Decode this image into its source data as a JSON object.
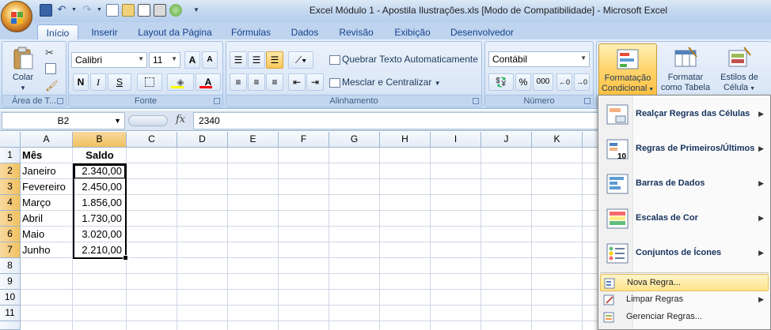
{
  "titlebar": {
    "title": "Excel Módulo 1 - Apostila Ilustrações.xls  [Modo de Compatibilidade] - Microsoft Excel"
  },
  "tabs": [
    {
      "label": "Início"
    },
    {
      "label": "Inserir"
    },
    {
      "label": "Layout da Página"
    },
    {
      "label": "Fórmulas"
    },
    {
      "label": "Dados"
    },
    {
      "label": "Revisão"
    },
    {
      "label": "Exibição"
    },
    {
      "label": "Desenvolvedor"
    }
  ],
  "ribbon": {
    "clipboard": {
      "paste_label": "Colar",
      "group_label": "Área de T..."
    },
    "font": {
      "name": "Calibri",
      "size": "11",
      "group_label": "Fonte",
      "bold": "N",
      "italic": "I",
      "underline": "S",
      "grow": "A",
      "shrink": "A",
      "color_letter": "A"
    },
    "alignment": {
      "wrap_label": "Quebrar Texto Automaticamente",
      "merge_label": "Mesclar e Centralizar",
      "group_label": "Alinhamento"
    },
    "number": {
      "format": "Contábil",
      "percent": "%",
      "thousands": "000",
      "group_label": "Número"
    },
    "styles": {
      "conditional_line1": "Formatação",
      "conditional_line2": "Condicional",
      "table_line1": "Formatar",
      "table_line2": "como Tabela",
      "cell_line1": "Estilos de",
      "cell_line2": "Célula"
    }
  },
  "formula_bar": {
    "name_box": "B2",
    "fx": "fx",
    "formula": "2340"
  },
  "grid": {
    "columns": [
      "A",
      "B",
      "C",
      "D",
      "E",
      "F",
      "G",
      "H",
      "I",
      "J",
      "K"
    ],
    "rows": [
      "1",
      "2",
      "3",
      "4",
      "5",
      "6",
      "7",
      "8",
      "9",
      "10",
      "11"
    ],
    "header": {
      "a": "Mês",
      "b": "Saldo"
    },
    "data": [
      {
        "month": "Janeiro",
        "balance": "2.340,00"
      },
      {
        "month": "Fevereiro",
        "balance": "2.450,00"
      },
      {
        "month": "Março",
        "balance": "1.856,00"
      },
      {
        "month": "Abril",
        "balance": "1.730,00"
      },
      {
        "month": "Maio",
        "balance": "3.020,00"
      },
      {
        "month": "Junho",
        "balance": "2.210,00"
      }
    ]
  },
  "menu": {
    "items_big": [
      {
        "label": "Realçar Regras das Células",
        "icon": "highlight-rules-icon"
      },
      {
        "label": "Regras de Primeiros/Últimos",
        "icon": "top-bottom-rules-icon"
      },
      {
        "label": "Barras de Dados",
        "icon": "data-bars-icon"
      },
      {
        "label": "Escalas de Cor",
        "icon": "color-scales-icon"
      },
      {
        "label": "Conjuntos de Ícones",
        "icon": "icon-sets-icon"
      }
    ],
    "items_small": [
      {
        "label": "Nova Regra...",
        "icon": "new-rule-icon"
      },
      {
        "label": "Limpar Regras",
        "icon": "clear-rules-icon"
      },
      {
        "label": "Gerenciar Regras...",
        "icon": "manage-rules-icon"
      }
    ]
  },
  "colors": {
    "accent": "#15428b",
    "selection": "#f9c75a",
    "ribbon": "#dbe7f6"
  }
}
